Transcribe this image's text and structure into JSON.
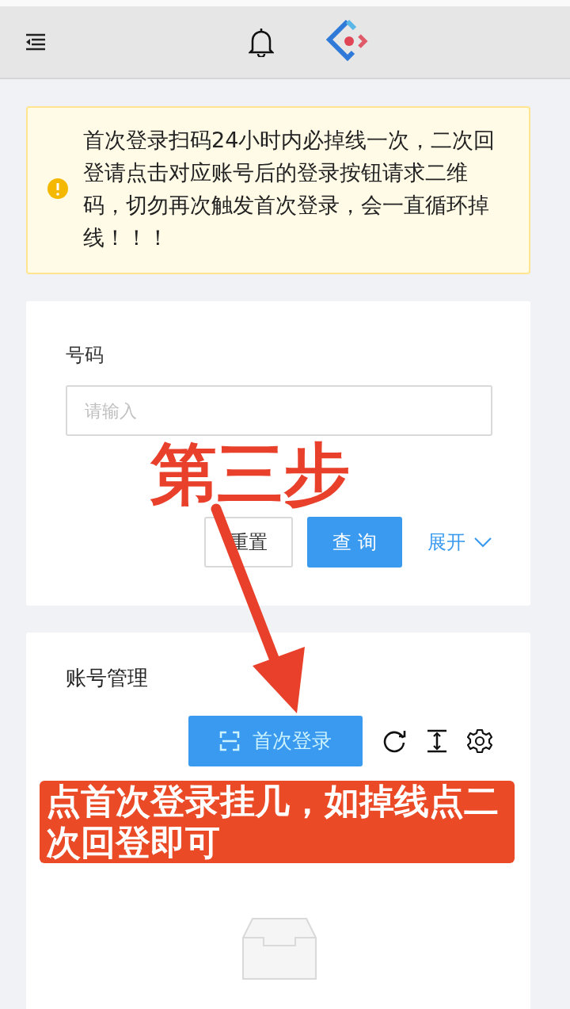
{
  "alert": {
    "text": "首次登录扫码24小时内必掉线一次，二次回登请点击对应账号后的登录按钮请求二维码，切勿再次触发首次登录，会一直循环掉线！！！"
  },
  "search_form": {
    "fields": [
      {
        "label": "号码",
        "placeholder": "请输入"
      }
    ],
    "buttons": [
      {
        "label": "重置",
        "kind": "default"
      },
      {
        "label": "查 询",
        "kind": "primary"
      }
    ],
    "expand": {
      "label": "展开",
      "expanded": false
    }
  },
  "account_panel": {
    "title": "账号管理",
    "primary_button": "首次登录"
  },
  "annotations": [
    {
      "kind": "step",
      "text": "第三步"
    },
    {
      "kind": "callout",
      "text": "点首次登录挂几，如掉线点二次回登即可"
    }
  ]
}
